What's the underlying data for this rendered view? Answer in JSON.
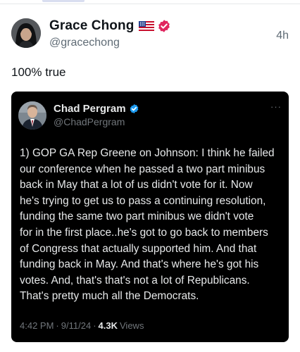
{
  "tweet": {
    "author": {
      "display_name": "Grace Chong",
      "handle": "@gracechong",
      "flag_icon": "us-flag-icon",
      "verified_icon": "pink-verified-badge-icon",
      "verified_color": "#e0245e"
    },
    "time_ago": "4h",
    "text": "100% true"
  },
  "quoted_tweet": {
    "author": {
      "display_name": "Chad Pergram",
      "handle": "@ChadPergram",
      "verified_icon": "blue-verified-badge-icon",
      "verified_color": "#1d9bf0"
    },
    "more_icon": "ellipsis-icon",
    "more_label": "···",
    "text": "1) GOP GA Rep Greene on Johnson: I think he failed\nour conference when he passed a two part minibus\nback in May that a lot of us didn't vote for it. Now\nhe's trying to get us to pass a continuing resolution,\nfunding the same two part minibus we didn't vote\nfor in the first place..he's got to go back to members\nof Congress that actually supported him. And that\nfunding back in May. And that's where he's got his\nvotes. And, that's that's not a lot of Republicans.\nThat's pretty much all the Democrats.",
    "time": "4:42 PM",
    "separator": "·",
    "date": "9/11/24",
    "views_count": "4.3K",
    "views_label": "Views"
  }
}
